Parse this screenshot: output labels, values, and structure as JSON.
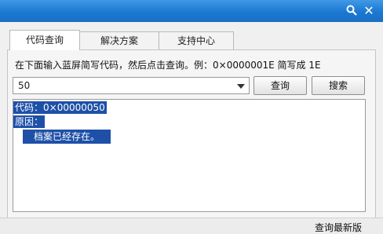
{
  "titlebar": {
    "search_icon": "search-icon",
    "close_icon": "close-icon",
    "close_glyph": "✕",
    "accent_color": "#1b78d2"
  },
  "tabs": [
    {
      "label": "代码查询",
      "active": true
    },
    {
      "label": "解决方案",
      "active": false
    },
    {
      "label": "支持中心",
      "active": false
    }
  ],
  "instruction": "在下面输入蓝屏简写代码，然后点击查询。例：0×0000001E 简写成 1E",
  "code_input": {
    "value": "50"
  },
  "buttons": {
    "query": "查询",
    "search": "搜索"
  },
  "result": {
    "code_line": "代码：0×00000050",
    "reason_label": "原因：",
    "reason_text": "档案已经存在。"
  },
  "statusbar": {
    "link": "查询最新版"
  }
}
